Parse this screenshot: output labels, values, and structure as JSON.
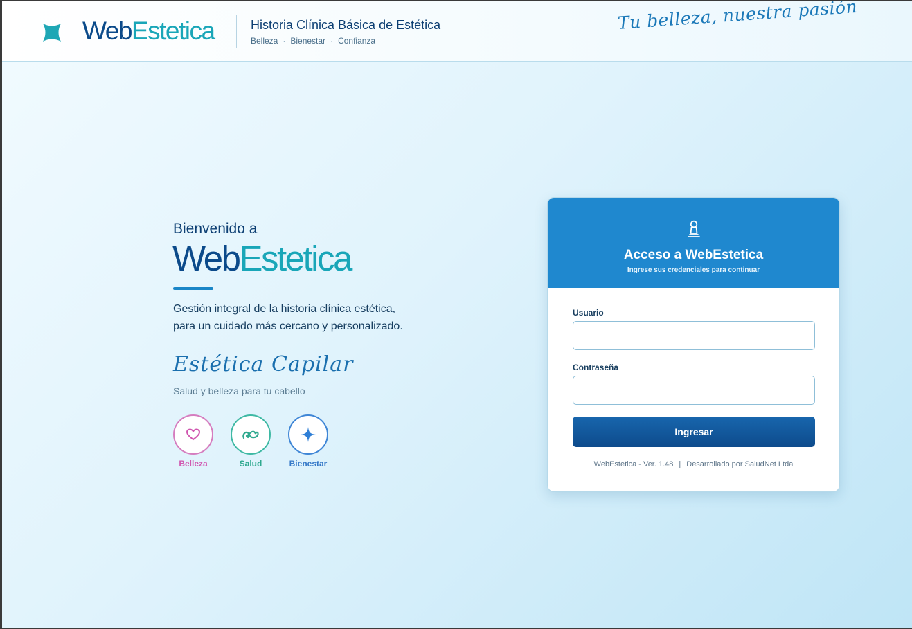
{
  "header": {
    "brand_web": "Web",
    "brand_estetica": "Estetica",
    "title": "Historia Clínica Básica de Estética",
    "subtitle_items": [
      "Belleza",
      "Bienestar",
      "Confianza"
    ],
    "subtitle_separator": "·",
    "tagline": "Tu belleza, nuestra pasión"
  },
  "welcome": {
    "greeting": "Bienvenido a",
    "brand_web": "Web",
    "brand_estetica": "Estetica",
    "description_line1": "Gestión integral de la historia clínica estética,",
    "description_line2": "para un cuidado más cercano y personalizado.",
    "capilar_title": "Estética Capilar",
    "capilar_subtitle": "Salud y belleza para tu cabello",
    "features": [
      {
        "label": "Belleza",
        "icon": "heart-icon",
        "color": "#d057b0"
      },
      {
        "label": "Salud",
        "icon": "hair-curl-icon",
        "color": "#2fa98f"
      },
      {
        "label": "Bienestar",
        "icon": "sparkle-icon",
        "color": "#3579c8"
      }
    ]
  },
  "login": {
    "title": "Acceso a WebEstetica",
    "subtitle": "Ingrese sus credenciales para continuar",
    "username_label": "Usuario",
    "username_value": "",
    "password_label": "Contraseña",
    "password_value": "",
    "submit_label": "Ingresar",
    "version": "WebEstetica - Ver. 1.48",
    "footer_separator": "|",
    "developer": "Desarrollado por SaludNet Ltda"
  },
  "colors": {
    "primary": "#1f88cf",
    "brand_dark": "#0b4a8a",
    "brand_teal": "#19a6b8",
    "button": "#0d4b8c"
  }
}
